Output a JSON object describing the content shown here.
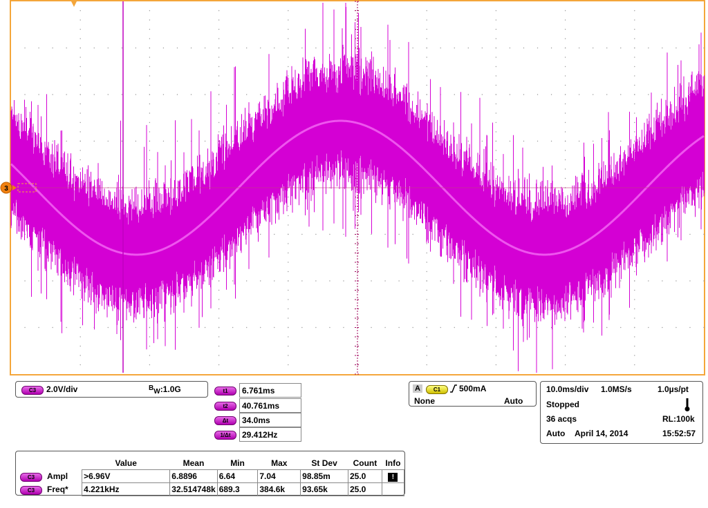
{
  "colors": {
    "frame": "#f4a63a",
    "trace": "#d400d4",
    "grid": "#aaaaaa",
    "trigger": "#a0005a"
  },
  "scope": {
    "channel_marker": "3",
    "trigger_arrow": "▼"
  },
  "channel_panel": {
    "badge": "C3",
    "scale": "2.0V/div",
    "bw_b": "B",
    "bw_w": "W",
    "bw_value": ":1.0G"
  },
  "cursors": [
    {
      "badge": "t1",
      "value": "6.761ms"
    },
    {
      "badge": "t2",
      "value": "40.761ms"
    },
    {
      "badge": "Δt",
      "value": "34.0ms"
    },
    {
      "badge": "1/Δt",
      "value": "29.412Hz"
    }
  ],
  "trigger_panel": {
    "mode": "A",
    "badge": "C1",
    "edge_icon": "rising-edge",
    "level": "500mA",
    "coupling": "None",
    "sweep": "Auto"
  },
  "acq_panel": {
    "timebase": "10.0ms/div",
    "rate": "1.0MS/s",
    "res": "1.0µs/pt",
    "state": "Stopped",
    "acqs": "36 acqs",
    "rl": "RL:100k",
    "mode": "Auto",
    "date": "April 14, 2014",
    "time": "15:52:57"
  },
  "measurements": {
    "headers": [
      "Value",
      "Mean",
      "Min",
      "Max",
      "St Dev",
      "Count",
      "Info"
    ],
    "rows": [
      {
        "badge": "C3",
        "name": "Ampl",
        "cells": [
          ">6.96V",
          "6.8896",
          "6.64",
          "7.04",
          "98.85m",
          "25.0"
        ],
        "info": "!"
      },
      {
        "badge": "C3",
        "name": "Freq*",
        "cells": [
          "4.221kHz",
          "32.514748k",
          "689.3",
          "384.6k",
          "93.65k",
          "25.0"
        ],
        "info": ""
      }
    ]
  }
}
